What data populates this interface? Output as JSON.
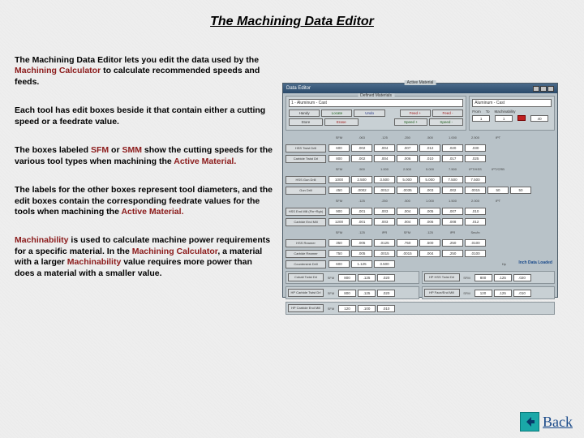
{
  "title": "The Machining Data Editor",
  "paragraphs": {
    "p1a": "The Machining Data Editor",
    "p1b": " lets you edit the data used by the ",
    "p1c": "Machining Calculator",
    "p1d": " to calculate recommended speeds and feeds.",
    "p2": "Each tool has edit boxes beside it that contain either a cutting speed or a feedrate value.",
    "p3a": "The boxes labeled ",
    "p3b": "SFM",
    "p3c": " or ",
    "p3d": "SMM",
    "p3e": " show the cutting speeds for the various tool types when machining the ",
    "p3f": "Active Material.",
    "p4a": "The labels for the other boxes represent tool diameters, and the edit boxes contain the corresponding feedrate values for the tools when machining the ",
    "p4b": "Active Material.",
    "p5a": "Machinability",
    "p5b": " is used to calculate machine power requirements for a specific material.  In the ",
    "p5c": "Machining Calculator",
    "p5d": ", a material with a larger ",
    "p5e": "Machinability",
    "p5f": " value requires more power than does a material with a smaller value."
  },
  "mini": {
    "titlebar": "Data Editor",
    "panel_left_label": "Defined Materials",
    "panel_right_label": "Active Material",
    "dd_left": "1 - Aluminum - Cast",
    "dd_right": "Aluminum - Cast",
    "btns": {
      "handy": "Handy",
      "locate": "Locate",
      "undo": "Undo",
      "store": "Store",
      "erase": "Erase",
      "feed": "Feed +",
      "feedm": "Feed -",
      "speed": "Speed +",
      "speedm": "Speed -"
    },
    "right_stats": {
      "from": "From",
      "to": "To",
      "mach": "Machinability",
      "from_v": "1",
      "to_v": "1",
      "mach_v": "40"
    },
    "headers1": [
      "SFM",
      ".063",
      ".125",
      ".250",
      ".500",
      "1.000",
      "2.500",
      "IPT"
    ],
    "rows1": [
      {
        "label": "HSS Twist Drill",
        "cells": [
          "600",
          ".002",
          ".004",
          ".007",
          ".012",
          ".020",
          ".030"
        ]
      },
      {
        "label": "Carbide Twist Drl",
        "cells": [
          "800",
          ".002",
          ".004",
          ".006",
          ".010",
          ".017",
          ".025"
        ]
      }
    ],
    "headers2": [
      "SFM",
      ".500",
      "1.000",
      "2.500",
      "5.000",
      "7.500",
      "IPT/HSS",
      "IPT/CRB"
    ],
    "rows2": [
      {
        "label": "HSS Gun Drill",
        "cells": [
          "1000",
          "2.500",
          "3.500",
          "5.000",
          "5.000",
          "7.500",
          "7.500"
        ]
      },
      {
        "label": "Gun Drill",
        "cells": [
          "450",
          ".0002",
          ".0012",
          ".0035",
          ".003",
          ".002",
          ".0015",
          "50",
          "50"
        ]
      }
    ],
    "headers3": [
      "SFM",
      ".125",
      ".250",
      ".500",
      "1.000",
      "1.500",
      "2.000",
      "IPT"
    ],
    "rows3": [
      {
        "label": "HSS End Mill (Fin+Rgh)",
        "cells": [
          "900",
          ".001",
          ".003",
          ".004",
          ".005",
          ".007",
          ".010"
        ]
      },
      {
        "label": "Carbide End Mill",
        "cells": [
          "1200",
          ".001",
          ".003",
          ".004",
          ".006",
          ".008",
          ".012"
        ]
      }
    ],
    "headers4": [
      "SFM",
      ".125",
      "IPR",
      "SFM",
      ".125",
      "IPR",
      "Sec/in"
    ],
    "rows4": [
      {
        "label": "HSS Reamer",
        "cells": [
          "350",
          ".005",
          ".0125",
          ".750",
          ".500",
          ".250",
          ".0100"
        ]
      },
      {
        "label": "Carbide Reamer",
        "cells": [
          "750",
          ".005",
          ".0015",
          ".0015",
          ".004",
          ".250",
          ".0100"
        ]
      }
    ],
    "rows5": [
      {
        "label": "Countersink Drill",
        "cells": [
          "600",
          "1.125",
          "3.500"
        ]
      }
    ],
    "inch_label": "Inch Data Loaded",
    "bottom": [
      {
        "label": "Cobalt Twist Drl",
        "h": "SFM",
        "v1": "800",
        "v2": ".125",
        "v3": ".020"
      },
      {
        "label": "HP HSS Twist Drl",
        "h": "SFM",
        "v1": "800",
        "v2": ".125",
        "v3": ".020"
      },
      {
        "label": "HP Carbide Twist Drl",
        "h": "SFM",
        "v1": "800",
        "v2": ".125",
        "v3": ".020"
      },
      {
        "label": "HP Face/End Mill",
        "h": "SFM",
        "v1": "120",
        "v2": ".125",
        "v3": ".010"
      },
      {
        "label": "HP Carbide End Mill",
        "h": "SFM",
        "v1": "120",
        "v2": ".100",
        "v3": ".010"
      }
    ]
  },
  "back": {
    "label": "Back"
  }
}
